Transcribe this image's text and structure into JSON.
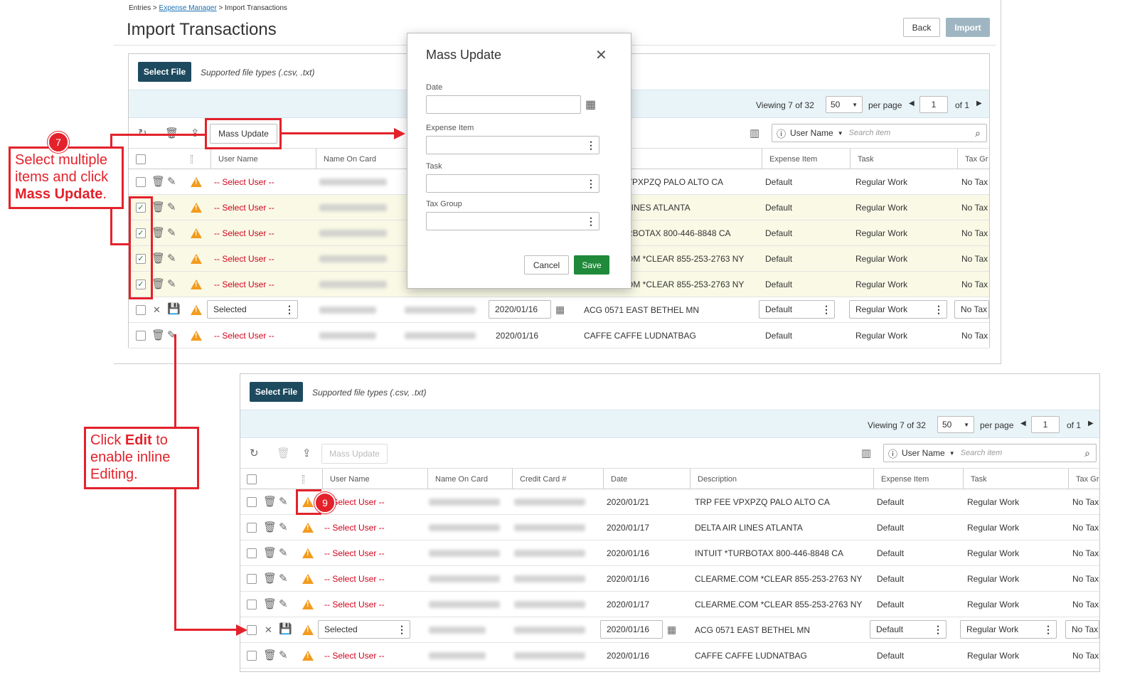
{
  "page": {
    "breadcrumb_entries": "Entries",
    "breadcrumb_sep": ">",
    "breadcrumb_manager": "Expense Manager",
    "breadcrumb_import": "Import Transactions",
    "title": "Import Transactions",
    "back_label": "Back",
    "import_label": "Import"
  },
  "panel": {
    "select_file": "Select File",
    "hint": "Supported file types (.csv, .txt)",
    "viewing_prefix": "Viewing",
    "viewing_count": "7",
    "viewing_of": "of",
    "viewing_total": "32",
    "per_page_value": "50",
    "per_page_label": "per page",
    "page_value": "1",
    "page_of": "of 1",
    "mass_update": "Mass Update",
    "search_field": "User Name",
    "search_placeholder": "Search item"
  },
  "columns": {
    "user_name": "User Name",
    "name_on_card": "Name On Card",
    "credit_card": "Credit Card #",
    "date": "Date",
    "description": "Description",
    "expense_item": "Expense Item",
    "task": "Task",
    "tax_group": "Tax Gr"
  },
  "rows": [
    {
      "user": "-- Select User --",
      "date": "2020/01/21",
      "desc": "TRP FEE VPXPZQ PALO ALTO CA",
      "desc_top": "VPXPZQ PALO ALTO CA",
      "expense": "Default",
      "task": "Regular Work",
      "tax": "No Tax"
    },
    {
      "user": "-- Select User --",
      "date": "2020/01/17",
      "desc": "DELTA AIR LINES ATLANTA",
      "desc_top": "LINES ATLANTA",
      "expense": "Default",
      "task": "Regular Work",
      "tax": "No Tax"
    },
    {
      "user": "-- Select User --",
      "date": "2020/01/16",
      "desc": "INTUIT *TURBOTAX 800-446-8848 CA",
      "desc_top": "RBOTAX 800-446-8848 CA",
      "expense": "Default",
      "task": "Regular Work",
      "tax": "No Tax"
    },
    {
      "user": "-- Select User --",
      "date": "2020/01/16",
      "desc": "CLEARME.COM *CLEAR 855-253-2763 NY",
      "desc_top": "OM *CLEAR 855-253-2763 NY",
      "expense": "Default",
      "task": "Regular Work",
      "tax": "No Tax"
    },
    {
      "user": "-- Select User --",
      "date": "2020/01/17",
      "desc": "CLEARME.COM *CLEAR 855-253-2763 NY",
      "desc_top": "OM *CLEAR 855-253-2763 NY",
      "expense": "Default",
      "task": "Regular Work",
      "tax": "No Tax"
    },
    {
      "user": "Selected",
      "date": "2020/01/16",
      "desc": "ACG 0571 EAST BETHEL MN",
      "desc_top": "ACG 0571 EAST BETHEL MN",
      "expense": "Default",
      "task": "Regular Work",
      "tax": "No Tax"
    },
    {
      "user": "-- Select User --",
      "date": "2020/01/16",
      "desc": "CAFFE CAFFE LUDNATBAG",
      "desc_top": "CAFFE CAFFE LUDNATBAG",
      "expense": "Default",
      "task": "Regular Work",
      "tax": "No Tax"
    }
  ],
  "modal": {
    "title": "Mass Update",
    "date_label": "Date",
    "expense_label": "Expense Item",
    "task_label": "Task",
    "tax_label": "Tax Group",
    "cancel": "Cancel",
    "save": "Save"
  },
  "callouts": {
    "step7_number": "7",
    "step7_line1": "Select multiple",
    "step7_line2": "items and click",
    "step7_bold": "Mass Update",
    "step7_end": ".",
    "edit_pre": "Click ",
    "edit_bold": "Edit",
    "edit_post": " to",
    "edit_line2": "enable inline",
    "edit_line3": "Editing.",
    "step9_number": "9"
  },
  "icons": [
    "refresh-icon",
    "trash-icon",
    "export-icon",
    "columns-icon",
    "info-icon",
    "search-icon",
    "pencil-icon",
    "save-icon",
    "close-icon",
    "warning-icon",
    "calendar-icon",
    "kebab-icon"
  ]
}
